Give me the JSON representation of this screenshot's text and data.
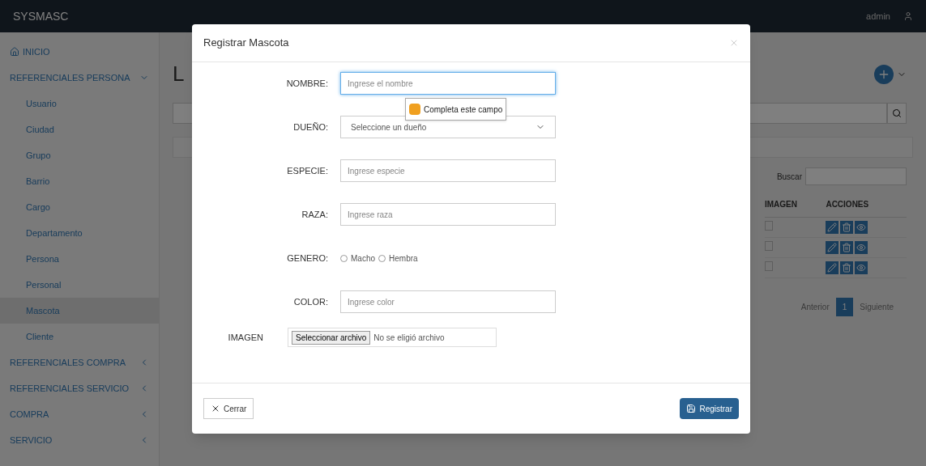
{
  "navbar": {
    "brand": "SYSMASC",
    "user": "admin"
  },
  "sidebar": {
    "items": [
      {
        "label": "INICIO",
        "kind": "home"
      },
      {
        "label": "REFERENCIALES PERSONA",
        "kind": "group",
        "expanded": true,
        "children": [
          {
            "label": "Usuario",
            "selected": false
          },
          {
            "label": "Ciudad",
            "selected": false
          },
          {
            "label": "Grupo",
            "selected": false
          },
          {
            "label": "Barrio",
            "selected": false
          },
          {
            "label": "Cargo",
            "selected": false
          },
          {
            "label": "Departamento",
            "selected": false
          },
          {
            "label": "Persona",
            "selected": false
          },
          {
            "label": "Personal",
            "selected": false
          },
          {
            "label": "Mascota",
            "selected": true
          },
          {
            "label": "Cliente",
            "selected": false
          }
        ]
      },
      {
        "label": "REFERENCIALES COMPRA",
        "kind": "group",
        "expanded": false
      },
      {
        "label": "REFERENCIALES SERVICIO",
        "kind": "group",
        "expanded": false
      },
      {
        "label": "COMPRA",
        "kind": "group",
        "expanded": false
      },
      {
        "label": "SERVICIO",
        "kind": "group",
        "expanded": false
      }
    ]
  },
  "page": {
    "heading": "L",
    "search_label": "Buscar",
    "table": {
      "columns": [
        "IMAGEN",
        "ACCIONES"
      ],
      "rows": [
        {
          "actions": [
            {
              "kind": "edit"
            },
            {
              "kind": "delete"
            },
            {
              "kind": "view"
            }
          ]
        },
        {
          "actions": [
            {
              "kind": "edit"
            },
            {
              "kind": "delete"
            },
            {
              "kind": "view"
            }
          ]
        },
        {
          "actions": [
            {
              "kind": "edit"
            },
            {
              "kind": "delete"
            },
            {
              "kind": "view"
            }
          ]
        }
      ]
    },
    "pagination": {
      "previous": "Anterior",
      "pages": [
        {
          "label": "1",
          "selected": true
        }
      ],
      "next": "Siguiente"
    }
  },
  "modal": {
    "title": "Registrar Mascota",
    "fields": [
      {
        "kind": "text",
        "label": "NOMBRE:",
        "placeholder": "Ingrese el nombre",
        "focused": true,
        "tooltip": "Completa este campo"
      },
      {
        "kind": "select",
        "label": "DUEÑO:",
        "value": "Seleccione un dueño"
      },
      {
        "kind": "text",
        "label": "ESPECIE:",
        "placeholder": "Ingrese especie",
        "focused": false
      },
      {
        "kind": "text",
        "label": "RAZA:",
        "placeholder": "Ingrese raza",
        "focused": false
      },
      {
        "kind": "radio",
        "label": "GENERO:",
        "options": [
          {
            "label": "Macho",
            "selected": false
          },
          {
            "label": "Hembra",
            "selected": false
          }
        ]
      },
      {
        "kind": "text",
        "label": "COLOR:",
        "placeholder": "Ingrese color",
        "focused": false
      },
      {
        "kind": "file",
        "label": "IMAGEN",
        "button": "Seleccionar archivo",
        "status": "No se eligió archivo"
      }
    ],
    "close_button": "Cerrar",
    "submit_button": "Registrar"
  }
}
